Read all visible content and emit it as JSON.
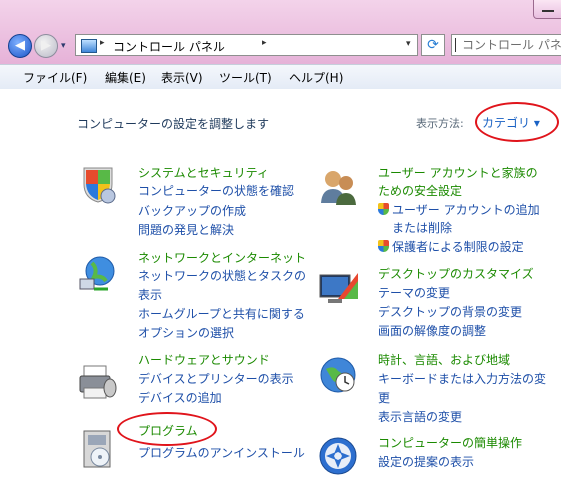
{
  "address_bar": {
    "breadcrumb": "コントロール パネル",
    "separator": "▸",
    "dropdown_arrow": "▾",
    "refresh_icon": "refresh-icon"
  },
  "search": {
    "placeholder": "コントロール パネ"
  },
  "nav": {
    "back_glyph": "◀",
    "forward_glyph": "▶",
    "recent_glyph": "▾"
  },
  "menu": [
    "ファイル(F)",
    "編集(E)",
    "表示(V)",
    "ツール(T)",
    "ヘルプ(H)"
  ],
  "main": {
    "heading": "コンピューターの設定を調整します",
    "view_by_label": "表示方法:",
    "view_by_value": "カテゴリ ▾"
  },
  "categories_left": [
    {
      "icon": "shield-icon",
      "title": "システムとセキュリティ",
      "links": [
        "コンピューターの状態を確認",
        "バックアップの作成",
        "問題の発見と解決"
      ]
    },
    {
      "icon": "network-icon",
      "title": "ネットワークとインターネット",
      "links": [
        "ネットワークの状態とタスクの",
        "表示",
        "ホームグループと共有に関する",
        "オプションの選択"
      ]
    },
    {
      "icon": "printer-icon",
      "title": "ハードウェアとサウンド",
      "links": [
        "デバイスとプリンターの表示",
        "デバイスの追加"
      ]
    },
    {
      "icon": "programs-icon",
      "title": "プログラム",
      "links": [
        "プログラムのアンインストール"
      ]
    }
  ],
  "categories_right": [
    {
      "icon": "users-icon",
      "title_lines": [
        "ユーザー アカウントと家族の",
        "ための安全設定"
      ],
      "links": [
        "ユーザー アカウントの追加",
        "または削除",
        "保護者による制限の設定"
      ]
    },
    {
      "icon": "display-icon",
      "title": "デスクトップのカスタマイズ",
      "links": [
        "テーマの変更",
        "デスクトップの背景の変更",
        "画面の解像度の調整"
      ]
    },
    {
      "icon": "globe-clock-icon",
      "title": "時計、言語、および地域",
      "links": [
        "キーボードまたは入力方法の変",
        "更",
        "表示言語の変更"
      ]
    },
    {
      "icon": "ease-of-access-icon",
      "title": "コンピューターの簡単操作",
      "links": [
        "設定の提案の表示"
      ]
    }
  ],
  "colors": {
    "category_title": "#1b8a00",
    "link": "#1e4fa8",
    "highlight_ring": "#e0141b",
    "chrome": "#e6b2d8"
  }
}
